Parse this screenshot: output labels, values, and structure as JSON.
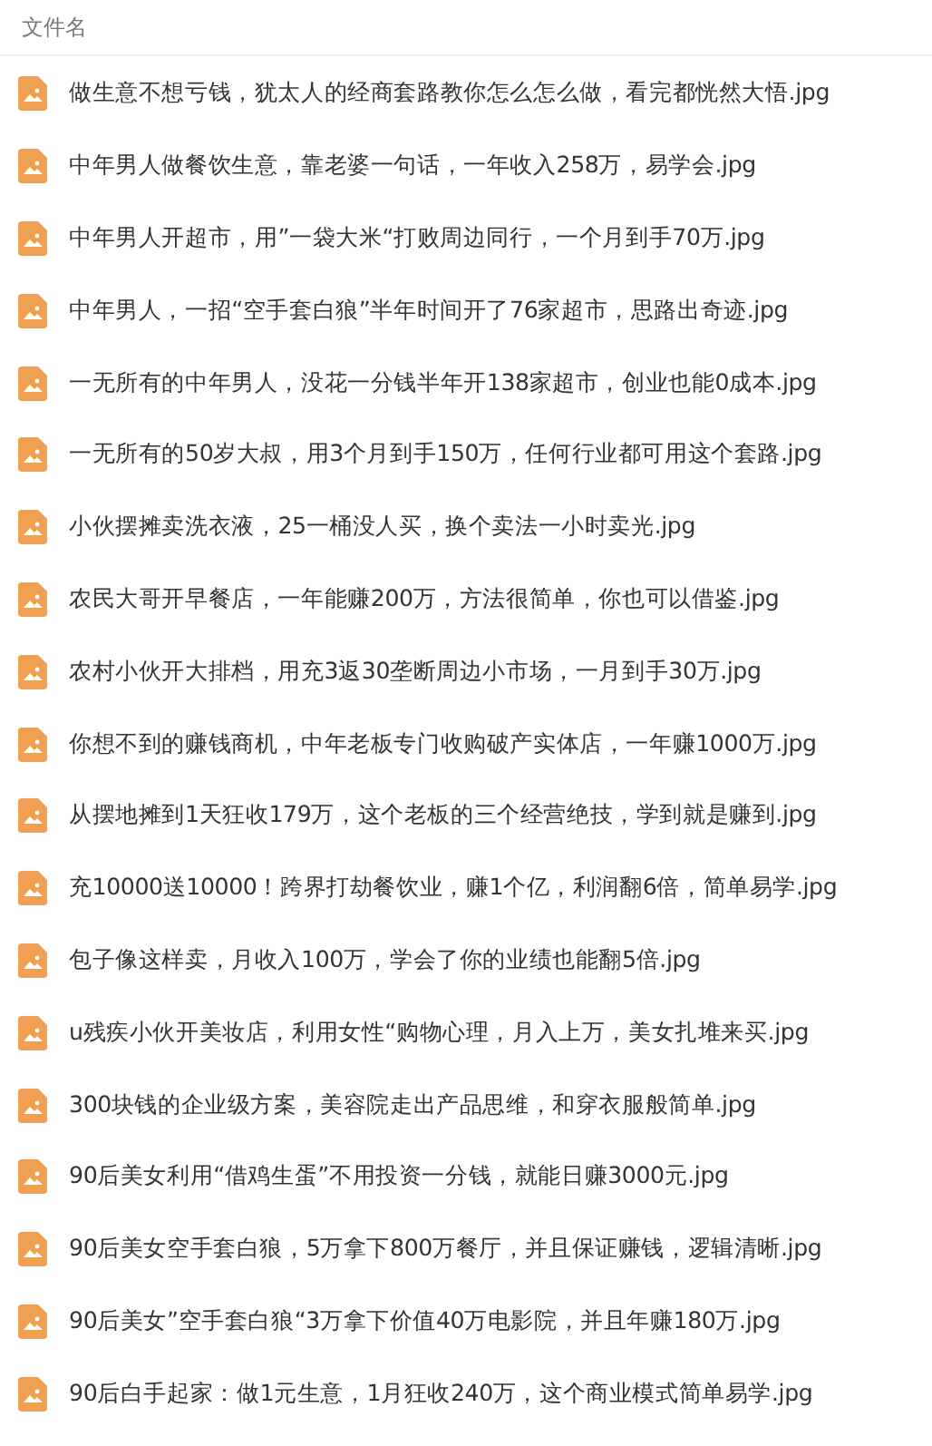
{
  "header": {
    "column_1": "文件名"
  },
  "files": [
    {
      "name": "做生意不想亏钱，犹太人的经商套路教你怎么怎么做，看完都恍然大悟.jpg"
    },
    {
      "name": "中年男人做餐饮生意，靠老婆一句话，一年收入258万，易学会.jpg"
    },
    {
      "name": "中年男人开超市，用”一袋大米“打败周边同行，一个月到手70万.jpg"
    },
    {
      "name": "中年男人，一招“空手套白狼”半年时间开了76家超市，思路出奇迹.jpg"
    },
    {
      "name": "一无所有的中年男人，没花一分钱半年开138家超市，创业也能0成本.jpg"
    },
    {
      "name": "一无所有的50岁大叔，用3个月到手150万，任何行业都可用这个套路.jpg"
    },
    {
      "name": "小伙摆摊卖洗衣液，25一桶没人买，换个卖法一小时卖光.jpg"
    },
    {
      "name": "农民大哥开早餐店，一年能赚200万，方法很简单，你也可以借鉴.jpg"
    },
    {
      "name": "农村小伙开大排档，用充3返30垄断周边小市场，一月到手30万.jpg"
    },
    {
      "name": "你想不到的赚钱商机，中年老板专门收购破产实体店，一年赚1000万.jpg"
    },
    {
      "name": "从摆地摊到1天狂收179万，这个老板的三个经营绝技，学到就是赚到.jpg"
    },
    {
      "name": "充10000送10000！跨界打劫餐饮业，赚1个亿，利润翻6倍，简单易学.jpg"
    },
    {
      "name": "包子像这样卖，月收入100万，学会了你的业绩也能翻5倍.jpg"
    },
    {
      "name": "u残疾小伙开美妆店，利用女性“购物心理，月入上万，美女扎堆来买.jpg"
    },
    {
      "name": "300块钱的企业级方案，美容院走出产品思维，和穿衣服般简单.jpg"
    },
    {
      "name": "90后美女利用“借鸡生蛋”不用投资一分钱，就能日赚3000元.jpg"
    },
    {
      "name": "90后美女空手套白狼，5万拿下800万餐厅，并且保证赚钱，逻辑清晰.jpg"
    },
    {
      "name": "90后美女”空手套白狼“3万拿下价值40万电影院，并且年赚180万.jpg"
    },
    {
      "name": "90后白手起家：做1元生意，1月狂收240万，这个商业模式简单易学.jpg"
    }
  ]
}
